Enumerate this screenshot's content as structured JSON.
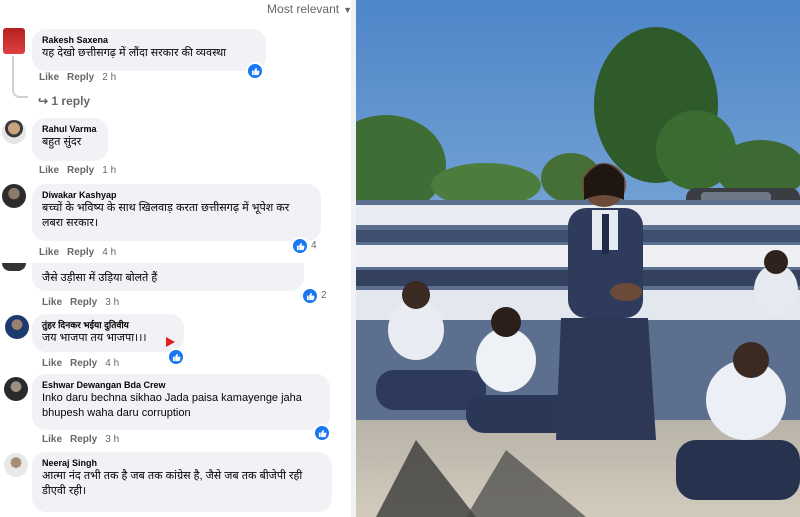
{
  "sort_label": "Most relevant",
  "comments": [
    {
      "name": "Rakesh Saxena",
      "text": "यह देखो छत्तीसगढ़ में लौंदा सरकार की व्यवस्था",
      "like": "Like",
      "reply": "Reply",
      "time": "2 h",
      "view_replies": "1 reply"
    },
    {
      "name": "Rahul Varma",
      "text": "बहुत सुंदर",
      "like": "Like",
      "reply": "Reply",
      "time": "1 h"
    },
    {
      "name": "Diwakar Kashyap",
      "text": "बच्चों के भविष्य के साथ खिलवाड़ करता छत्तीसगढ़ में भूपेश कर लबरा सरकार।",
      "like": "Like",
      "reply": "Reply",
      "time": "4 h",
      "likes": "4"
    },
    {
      "text": "जैसे उड़ीसा में उड़िया बोलते हैं",
      "like": "Like",
      "reply": "Reply",
      "time": "3 h",
      "likes": "2"
    },
    {
      "name": "तुंहर दिनकर भईया दुतिवीय",
      "text": "जय भाजपा तय भाजपा।।।",
      "like": "Like",
      "reply": "Reply",
      "time": "4 h"
    },
    {
      "name": "Eshwar Dewangan Bda Crew",
      "text": "Inko daru bechna sikhao Jada paisa kamayenge jaha bhupesh waha daru corruption",
      "like": "Like",
      "reply": "Reply",
      "time": "3 h"
    },
    {
      "name": "Neeraj Singh",
      "text": "आत्मा नंद तभी तक है जब तक कांग्रेस है, जैसे जब तक बीजेपी रही डीएवी रही।"
    }
  ],
  "colors": {
    "facebook_blue": "#1877f2",
    "bubble": "#f0f2f5",
    "meta_grey": "#65676b"
  }
}
